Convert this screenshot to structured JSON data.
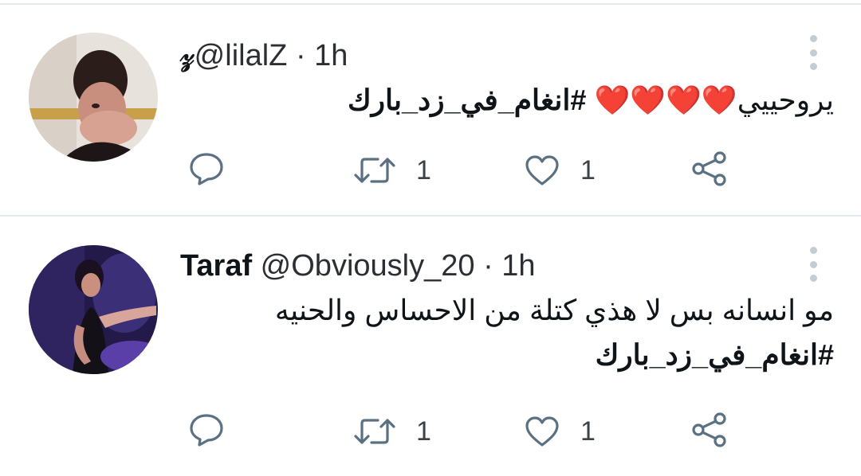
{
  "tweets": [
    {
      "display_name": "",
      "name_glyph": "𝓏",
      "handle": "@lilalZ",
      "separator": "·",
      "time": "1h",
      "text_line1_plain": "يروحييي",
      "text_line1_hearts": "❤️❤️❤️❤️",
      "text_line1_hashtag": "#انغام_في_زد_بارك",
      "actions": {
        "reply_count": "",
        "retweet_count": "1",
        "like_count": "1"
      }
    },
    {
      "display_name": "Taraf",
      "handle": "@Obviously_20",
      "separator": "·",
      "time": "1h",
      "text_line1": "مو انسانه بس لا هذي كتلة من الاحساس والحنيه",
      "text_line2_hashtag": "#انغام_في_زد_بارك",
      "actions": {
        "reply_count": "",
        "retweet_count": "1",
        "like_count": "1"
      }
    }
  ],
  "icons": {
    "reply": "reply-icon",
    "retweet": "retweet-icon",
    "like": "like-icon",
    "share": "share-icon",
    "more": "more-vertical-icon"
  },
  "colors": {
    "icon": "#5b7083",
    "divider": "#e6e9ec",
    "heart": "#e0245e"
  }
}
